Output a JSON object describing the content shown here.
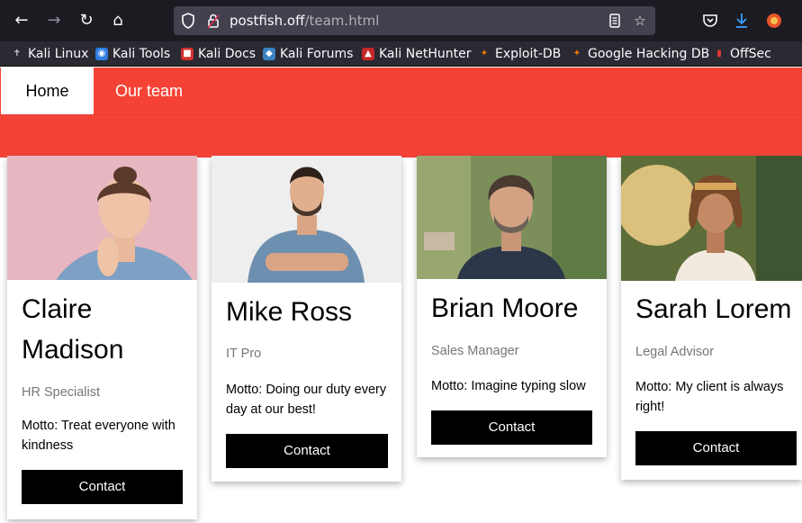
{
  "browser": {
    "url_host": "postfish.off",
    "url_path": "/team.html",
    "bookmarks": [
      {
        "label": "Kali Linux",
        "icon": "kali-dragon-icon"
      },
      {
        "label": "Kali Tools",
        "icon": "kali-tools-icon"
      },
      {
        "label": "Kali Docs",
        "icon": "kali-docs-icon"
      },
      {
        "label": "Kali Forums",
        "icon": "kali-forums-icon"
      },
      {
        "label": "Kali NetHunter",
        "icon": "kali-nethunter-icon"
      },
      {
        "label": "Exploit-DB",
        "icon": "exploit-db-icon"
      },
      {
        "label": "Google Hacking DB",
        "icon": "ghdb-icon"
      },
      {
        "label": "OffSec",
        "icon": "offsec-icon"
      }
    ]
  },
  "nav": {
    "home": "Home",
    "team": "Our team",
    "accent": "#f44336"
  },
  "team": [
    {
      "name": "Claire Madison",
      "role": "HR Specialist",
      "motto": "Motto: Treat everyone with kindness",
      "contact": "Contact"
    },
    {
      "name": "Mike Ross",
      "role": "IT Pro",
      "motto": "Motto: Doing our duty every day at our best!",
      "contact": "Contact"
    },
    {
      "name": "Brian Moore",
      "role": "Sales Manager",
      "motto": "Motto: Imagine typing slow",
      "contact": "Contact"
    },
    {
      "name": "Sarah Lorem",
      "role": "Legal Advisor",
      "motto": "Motto: My client is always right!",
      "contact": "Contact"
    }
  ]
}
